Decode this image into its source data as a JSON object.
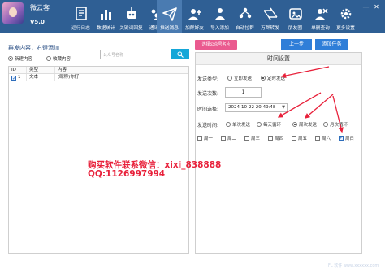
{
  "app": {
    "name": "微云客",
    "version": "V5.0"
  },
  "toolbar": [
    {
      "label": "运行日志",
      "icon": "log-icon"
    },
    {
      "label": "数据统计",
      "icon": "stats-icon"
    },
    {
      "label": "关键词回复",
      "icon": "robot-reply-icon"
    },
    {
      "label": "通讯录",
      "icon": "contacts-icon"
    },
    {
      "label": "推送消息",
      "icon": "send-icon",
      "active": true
    },
    {
      "label": "加群好友",
      "icon": "add-group-friend-icon"
    },
    {
      "label": "导入添加",
      "icon": "import-add-icon"
    },
    {
      "label": "自动拉群",
      "icon": "auto-group-icon"
    },
    {
      "label": "万群转发",
      "icon": "forward-icon"
    },
    {
      "label": "朋友圈",
      "icon": "moments-icon"
    },
    {
      "label": "单删查询",
      "icon": "delete-query-icon"
    },
    {
      "label": "更多设置",
      "icon": "settings-icon"
    }
  ],
  "left": {
    "title": "群发内容，右键添加",
    "radios": [
      {
        "label": "新建内容",
        "checked": true
      },
      {
        "label": "收藏内容",
        "checked": false
      }
    ],
    "search_placeholder": "公众号名称",
    "columns": {
      "id": "ID",
      "type": "类型",
      "content": "内容"
    },
    "rows": [
      {
        "id": "1",
        "type": "文本",
        "content": "(昵称)你好",
        "checked": true
      }
    ]
  },
  "right": {
    "pick_button": "选择公众号名片",
    "prev_button": "上一步",
    "add_button": "添加任务",
    "panel_title": "时间设置",
    "send_type": {
      "label": "发送类型:",
      "options": [
        {
          "label": "立即发送",
          "checked": false
        },
        {
          "label": "定时发送",
          "checked": true
        }
      ]
    },
    "send_count": {
      "label": "发送次数:",
      "value": "1"
    },
    "time_select": {
      "label": "时间选择:",
      "value": "2024-10-22 20:49:48"
    },
    "send_time": {
      "label": "发送时间:",
      "options": [
        {
          "label": "单次发送",
          "checked": false
        },
        {
          "label": "每天循环",
          "checked": false
        },
        {
          "label": "周次发送",
          "checked": true
        },
        {
          "label": "月次循环",
          "checked": false
        }
      ]
    },
    "weekdays": [
      {
        "label": "周一",
        "checked": false
      },
      {
        "label": "周二",
        "checked": false
      },
      {
        "label": "周三",
        "checked": false
      },
      {
        "label": "周四",
        "checked": false
      },
      {
        "label": "周五",
        "checked": false
      },
      {
        "label": "周六",
        "checked": false
      },
      {
        "label": "周日",
        "checked": true
      }
    ]
  },
  "watermark": {
    "line1": "购买软件联系微信：xixi_838888",
    "line2": "QQ:1126997994",
    "footer": "FL 软件 www.xxxxxx.com"
  },
  "colors": {
    "toolbar": "#2f5f94",
    "primary": "#2f7ed8",
    "pink": "#ea5a8f",
    "promo": "#e8203a",
    "annotation": "#e8203a"
  }
}
